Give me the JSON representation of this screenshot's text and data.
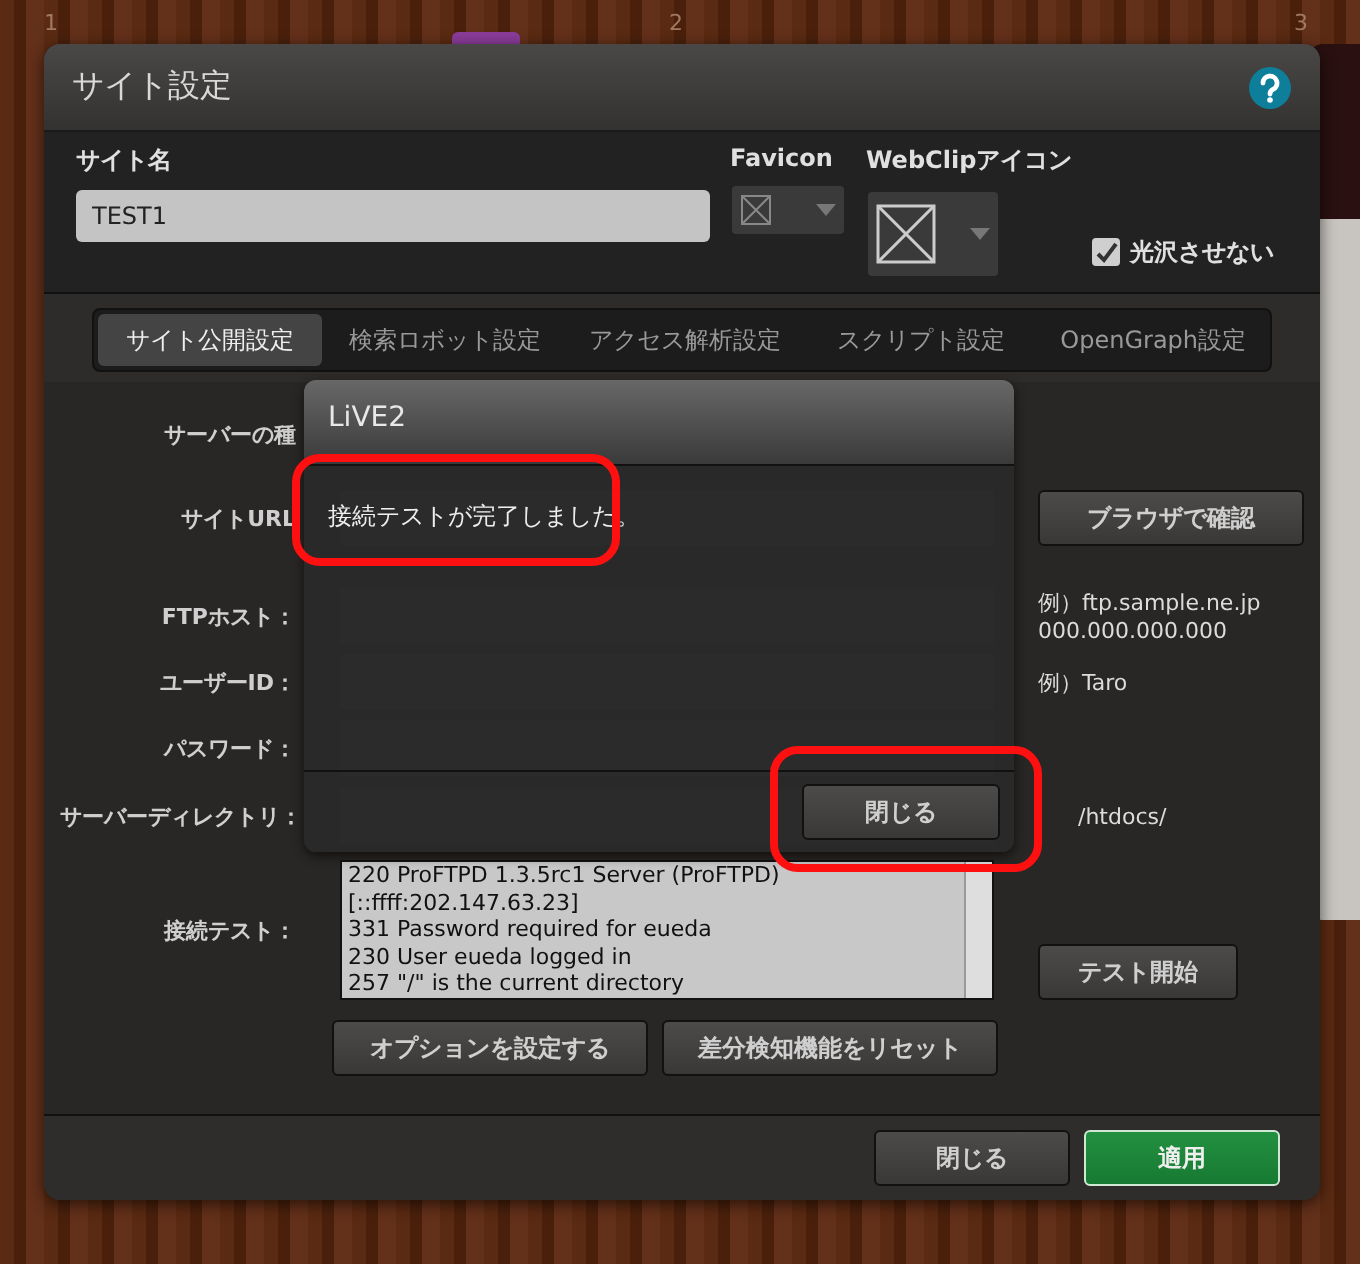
{
  "page_markers": [
    "1",
    "2",
    "3"
  ],
  "window": {
    "title": "サイト設定"
  },
  "site_name": {
    "label": "サイト名",
    "value": "TEST1"
  },
  "favicon": {
    "label": "Favicon"
  },
  "webclip": {
    "label": "WebClipアイコン"
  },
  "no_gloss": {
    "label": "光沢させない",
    "checked": true
  },
  "tabs": [
    {
      "label": "サイト公開設定",
      "selected": true
    },
    {
      "label": "検索ロボット設定",
      "selected": false
    },
    {
      "label": "アクセス解析設定",
      "selected": false
    },
    {
      "label": "スクリプト設定",
      "selected": false
    },
    {
      "label": "OpenGraph設定",
      "selected": false
    }
  ],
  "form": {
    "rows": [
      {
        "kind": "select",
        "label": "サーバーの種"
      },
      {
        "kind": "field",
        "label": "サイトURL",
        "button": "ブラウザで確認"
      },
      {
        "kind": "field",
        "label": "FTPホスト：",
        "hints": [
          "例）ftp.sample.ne.jp",
          "000.000.000.000"
        ]
      },
      {
        "kind": "field",
        "label": "ユーザーID：",
        "hints": [
          "例）Taro"
        ]
      },
      {
        "kind": "field",
        "label": "パスワード："
      },
      {
        "kind": "field",
        "label": "サーバーディレクトリ：",
        "hints": [
          "/htdocs/"
        ]
      }
    ]
  },
  "connection_test": {
    "label": "接続テスト：",
    "log": [
      "220 ProFTPD 1.3.5rc1 Server (ProFTPD)",
      "[::ffff:202.147.63.23]",
      "331 Password required for eueda",
      "230 User eueda logged in",
      "257 \"/\" is the current directory"
    ],
    "button": "テスト開始"
  },
  "actions": [
    "オプションを設定する",
    "差分検知機能をリセット"
  ],
  "footer": [
    {
      "label": "閉じる",
      "kind": "secondary"
    },
    {
      "label": "適用",
      "kind": "primary"
    }
  ],
  "dialog": {
    "title": "LiVE2",
    "message": {
      "text": "接続テストが完了しました。",
      "highlighted": true
    },
    "button": {
      "label": "閉じる",
      "highlighted": true
    }
  }
}
